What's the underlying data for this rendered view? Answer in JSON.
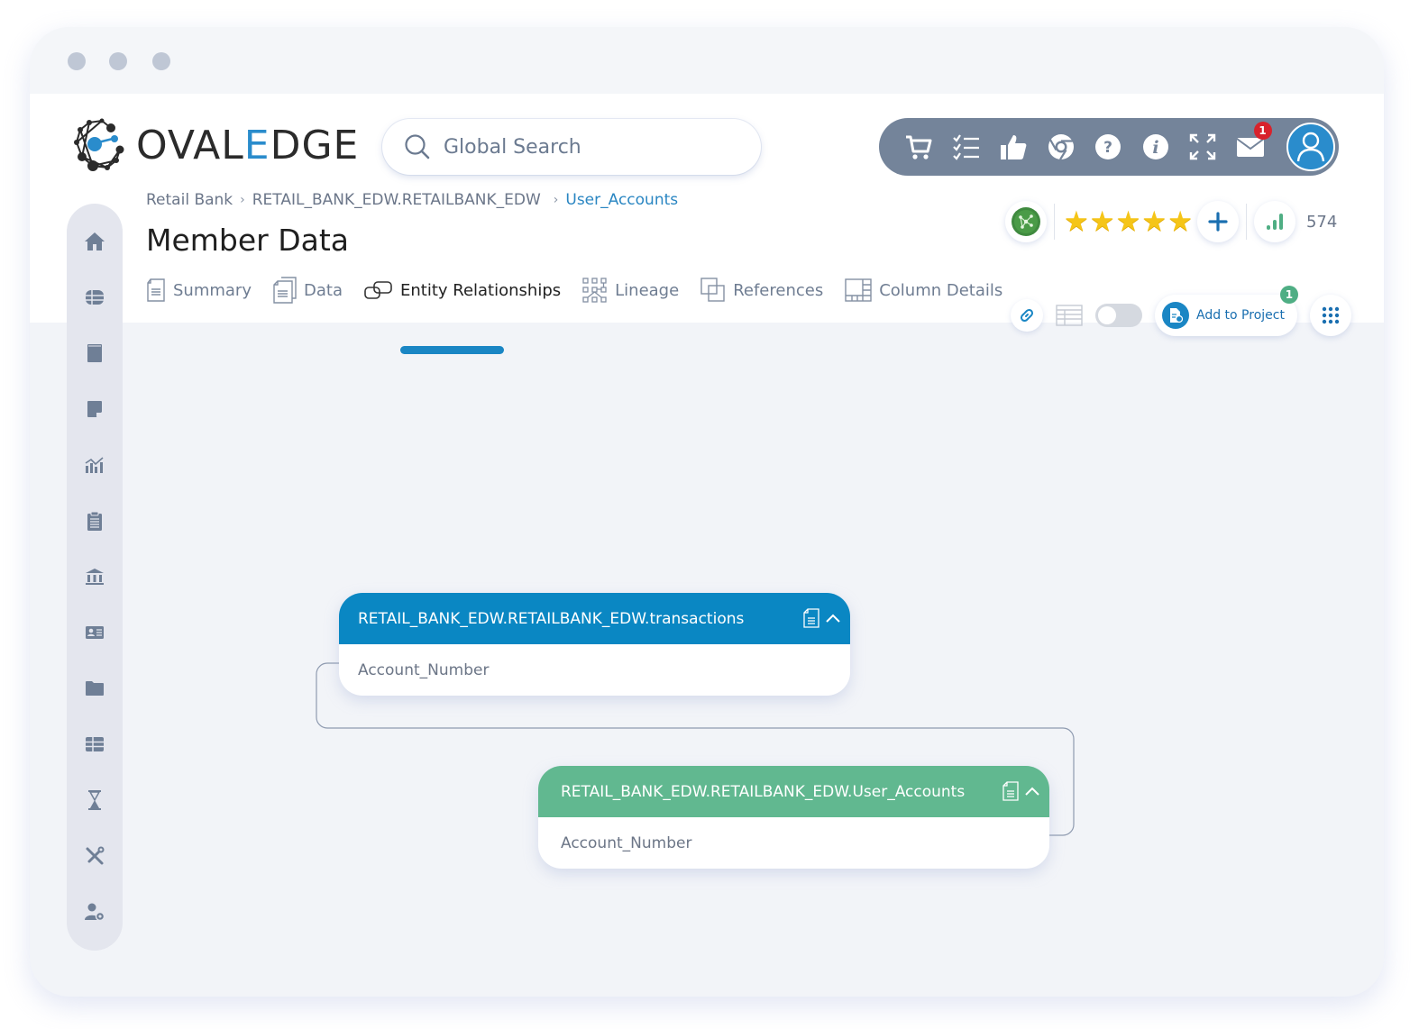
{
  "window": {
    "controls": [
      "close",
      "minimize",
      "maximize"
    ]
  },
  "brand": {
    "name_prefix": "OVAL",
    "name_accent": "E",
    "name_suffix": "DGE",
    "accent_color": "#2a8ccc"
  },
  "search": {
    "placeholder": "Global Search",
    "value": ""
  },
  "topbar": {
    "icons": [
      "cart-icon",
      "checklist-icon",
      "thumbs-up-icon",
      "chrome-icon",
      "help-icon",
      "info-icon",
      "fullscreen-icon",
      "mail-icon"
    ],
    "mail_badge": "1",
    "background": "#74849a"
  },
  "breadcrumb": {
    "items": [
      "Retail Bank",
      "RETAIL_BANK_EDW.RETAILBANK_EDW",
      "User_Accounts"
    ],
    "separator": "›"
  },
  "page": {
    "title": "Member Data"
  },
  "tabs": [
    {
      "label": "Summary",
      "icon": "document-icon",
      "active": false
    },
    {
      "label": "Data",
      "icon": "documents-icon",
      "active": false
    },
    {
      "label": "Entity Relationships",
      "icon": "entity-relationship-icon",
      "active": true
    },
    {
      "label": "Lineage",
      "icon": "lineage-icon",
      "active": false
    },
    {
      "label": "References",
      "icon": "references-icon",
      "active": false
    },
    {
      "label": "Column Details",
      "icon": "column-details-icon",
      "active": false
    }
  ],
  "rating": {
    "stars": 5,
    "max_stars": 5,
    "view_count": "574"
  },
  "actions": {
    "add_to_project_label": "Add to Project",
    "project_badge": "1",
    "toggle_on": false
  },
  "sidebar": {
    "items": [
      "home",
      "database",
      "book",
      "note",
      "analytics",
      "clipboard",
      "institution",
      "contact-card",
      "folder",
      "table-grid",
      "hourglass",
      "tools",
      "user-settings"
    ]
  },
  "entities": [
    {
      "name": "RETAIL_BANK_EDW.RETAILBANK_EDW.transactions",
      "columns": [
        "Account_Number"
      ],
      "header_color": "#0a87c3"
    },
    {
      "name": "RETAIL_BANK_EDW.RETAILBANK_EDW.User_Accounts",
      "columns": [
        "Account_Number"
      ],
      "header_color": "#61b890"
    }
  ]
}
